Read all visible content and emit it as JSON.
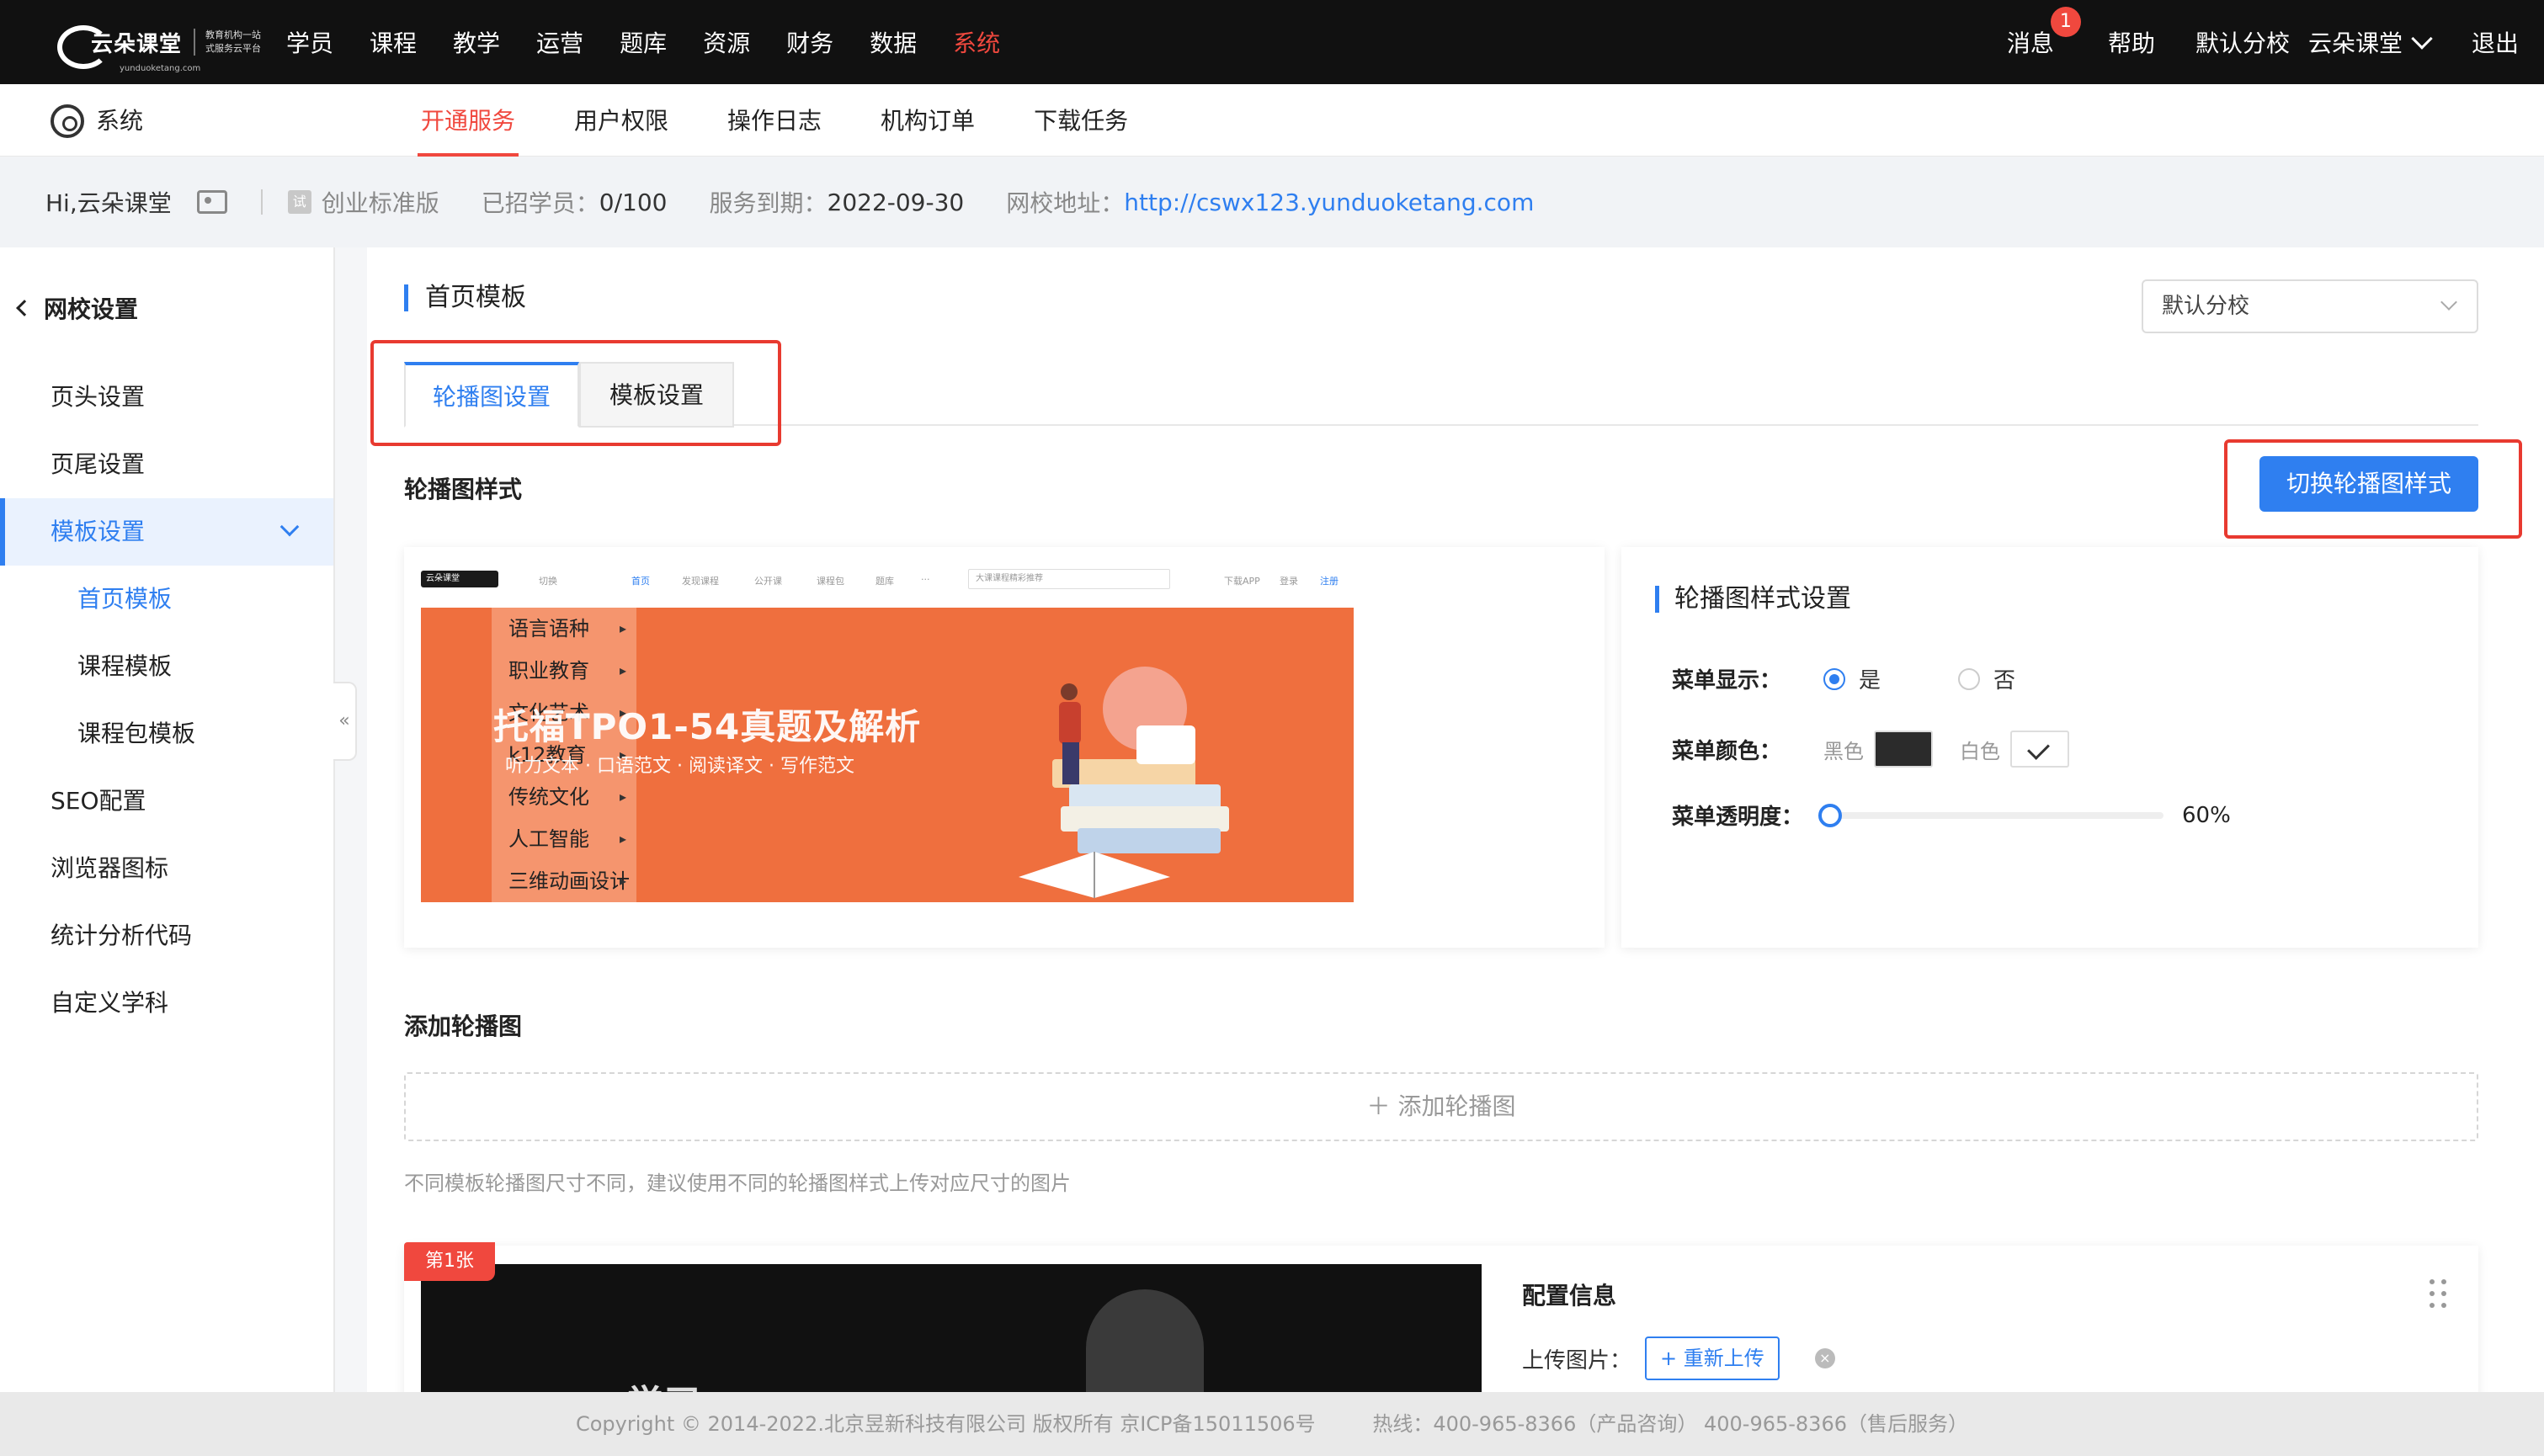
{
  "topbar": {
    "logo_text": "云朵课堂",
    "logo_sub1": "教育机构一站",
    "logo_sub2": "式服务云平台",
    "logo_url": "yunduoketang.com",
    "nav": [
      "学员",
      "课程",
      "教学",
      "运营",
      "题库",
      "资源",
      "财务",
      "数据",
      "系统"
    ],
    "active_nav": "系统",
    "message_label": "消息",
    "message_count": "1",
    "help_label": "帮助",
    "school_label": "默认分校",
    "account_label": "云朵课堂",
    "logout_label": "退出"
  },
  "subnav": {
    "section_label": "系统",
    "tabs": [
      "开通服务",
      "用户权限",
      "操作日志",
      "机构订单",
      "下载任务"
    ],
    "active_tab": "开通服务"
  },
  "infobar": {
    "greeting": "Hi,云朵课堂",
    "edition_icon_text": "试",
    "edition": "创业标准版",
    "students_label": "已招学员：",
    "students_value": "0/100",
    "expire_label": "服务到期：",
    "expire_value": "2022-09-30",
    "url_label": "网校地址：",
    "url_value": "http://cswx123.yunduoketang.com"
  },
  "sidebar": {
    "back_label": "网校设置",
    "items": [
      {
        "label": "页头设置"
      },
      {
        "label": "页尾设置"
      },
      {
        "label": "模板设置"
      },
      {
        "label": "首页模板"
      },
      {
        "label": "课程模板"
      },
      {
        "label": "课程包模板"
      },
      {
        "label": "SEO配置"
      },
      {
        "label": "浏览器图标"
      },
      {
        "label": "统计分析代码"
      },
      {
        "label": "自定义学科"
      }
    ],
    "collapse_glyph": "«"
  },
  "main": {
    "page_title": "首页模板",
    "branch_select": "默认分校",
    "tabs": [
      "轮播图设置",
      "模板设置"
    ],
    "active_tab": "轮播图设置",
    "carousel_style_title": "轮播图样式",
    "switch_button": "切换轮播图样式",
    "preview": {
      "mini_logo": "云朵课堂",
      "mini_nav": [
        "切换",
        "首页",
        "发现课程",
        "公开课",
        "课程包",
        "题库",
        "···"
      ],
      "mini_search": "大课课程精彩推荐",
      "mini_right": [
        "下载APP",
        "登录",
        "注册"
      ],
      "menu": [
        "语言语种",
        "职业教育",
        "文化艺术",
        "k12教育",
        "传统文化",
        "人工智能",
        "三维动画设计"
      ],
      "banner_title": "托福TPO1-54真题及解析",
      "banner_subtitle": "听力文本 · 口语范文 · 阅读译文 · 写作范文"
    },
    "style_settings": {
      "title": "轮播图样式设置",
      "menu_display_label": "菜单显示：",
      "yes": "是",
      "no": "否",
      "menu_display_value": "是",
      "menu_color_label": "菜单颜色：",
      "black_label": "黑色",
      "white_label": "白色",
      "menu_color_value": "白色",
      "opacity_label": "菜单透明度：",
      "opacity_value": "60%",
      "slider_fraction": 0
    },
    "add_carousel_title": "添加轮播图",
    "add_carousel_button": "＋ 添加轮播图",
    "hint": "不同模板轮播图尺寸不同，建议使用不同的轮播图样式上传对应尺寸的图片",
    "slide": {
      "tag": "第1张",
      "image_text": "学习",
      "config_title": "配置信息",
      "upload_label": "上传图片：",
      "reupload_button": "+ 重新上传",
      "delete_glyph": "×"
    }
  },
  "footer": {
    "copyright": "Copyright © 2014-2022.北京昱新科技有限公司 版权所有 京ICP备15011506号",
    "hotline": "热线：400-965-8366（产品咨询） 400-965-8366（售后服务）"
  },
  "colors": {
    "accent": "#2f7ff0",
    "brand_red": "#f0483e",
    "banner_orange": "#ef6f3e",
    "highlight_box": "#e83a30"
  }
}
